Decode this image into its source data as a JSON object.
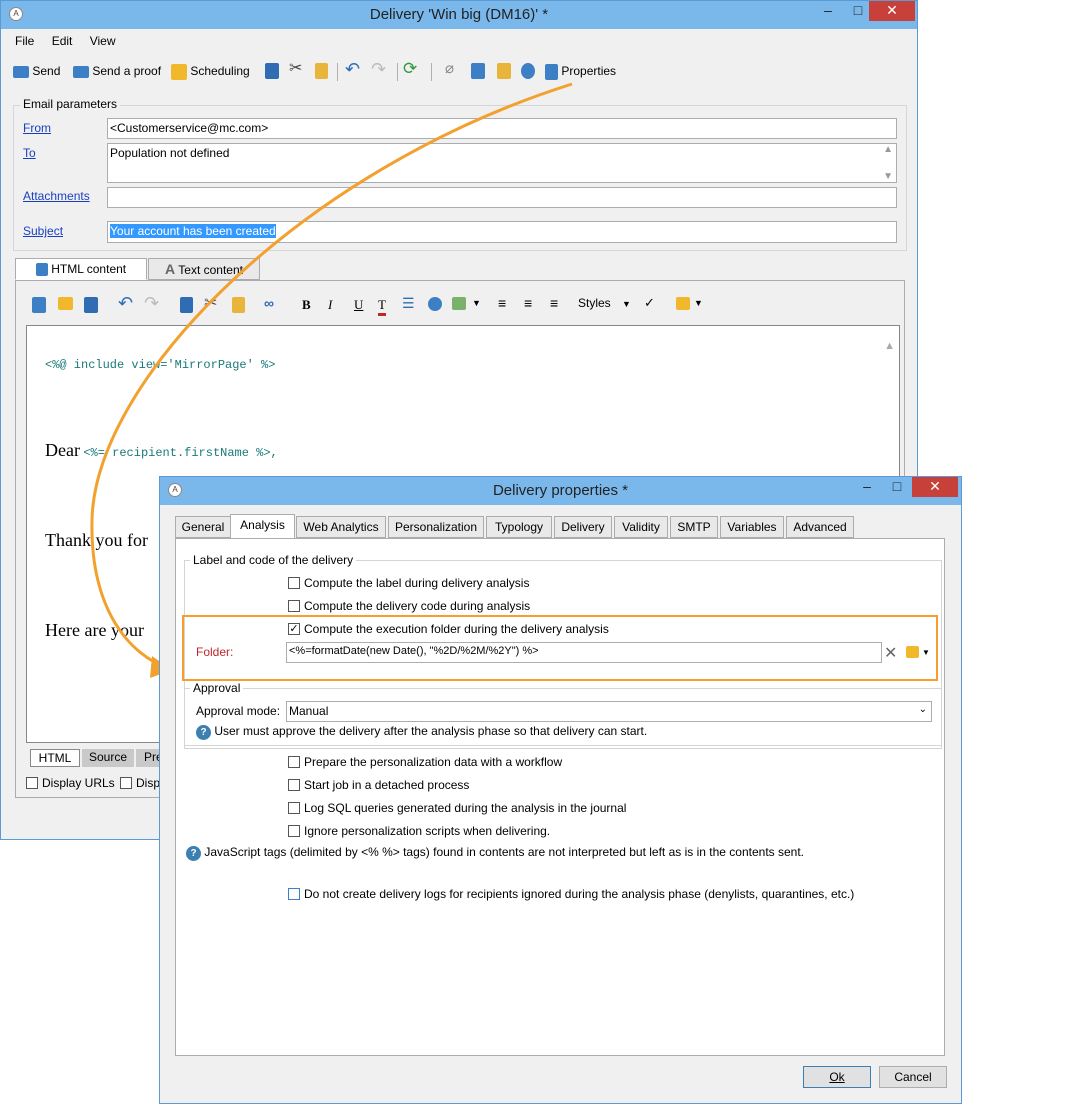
{
  "main_window": {
    "title": "Delivery 'Win big (DM16)' *",
    "menu": [
      "File",
      "Edit",
      "View"
    ],
    "toolbar": {
      "send": "Send",
      "send_proof": "Send a proof",
      "scheduling": "Scheduling",
      "properties": "Properties"
    },
    "email_params": {
      "legend": "Email parameters",
      "from_label": "From",
      "from_value": "<Customerservice@mc.com>",
      "to_label": "To",
      "to_value": "Population not defined",
      "attachments_label": "Attachments",
      "subject_label": "Subject",
      "subject_value": "Your account has been created"
    },
    "content_tabs": [
      "HTML content",
      "Text content"
    ],
    "editor_toolbar": {
      "styles": "Styles"
    },
    "editor": {
      "include_line": "<%@ include view='MirrorPage' %>",
      "dear": "Dear",
      "dear_code": "<%= recipient.firstName %>,",
      "thank_you": "Thank you for",
      "here_are": "Here are your"
    },
    "bottom_tabs": [
      "HTML",
      "Source",
      "Pre"
    ],
    "options": {
      "display_urls": "Display URLs",
      "display_other": "Displ"
    }
  },
  "dialog": {
    "title": "Delivery properties *",
    "tabs": [
      "General",
      "Analysis",
      "Web Analytics",
      "Personalization",
      "Typology",
      "Delivery",
      "Validity",
      "SMTP",
      "Variables",
      "Advanced"
    ],
    "active_tab": "Analysis",
    "label_code_section": {
      "legend": "Label and code of the delivery",
      "compute_label": "Compute the label during delivery analysis",
      "compute_code": "Compute the delivery code during analysis",
      "compute_folder": "Compute the execution folder during the delivery analysis",
      "folder_label": "Folder:",
      "folder_value": "<%=formatDate(new Date(), \"%2D/%2M/%2Y\") %>"
    },
    "approval_section": {
      "legend": "Approval",
      "mode_label": "Approval mode:",
      "mode_value": "Manual",
      "help_text": "User must approve the delivery after the analysis phase so that delivery can start."
    },
    "options": {
      "prepare_workflow": "Prepare the personalization data with a workflow",
      "start_detached": "Start job in a detached process",
      "log_sql": "Log SQL queries generated during the analysis in the journal",
      "ignore_scripts": "Ignore personalization scripts when delivering.",
      "js_help": "JavaScript tags (delimited by <% %> tags) found in contents are not interpreted but left as is in the contents sent.",
      "no_logs": "Do not create delivery logs for recipients ignored during the analysis phase (denylists, quarantines, etc.)"
    },
    "buttons": {
      "ok": "Ok",
      "cancel": "Cancel"
    }
  },
  "colors": {
    "titlebar": "#7ab8ec",
    "accent_orange": "#f2a12e",
    "link": "#1a3fbd",
    "folder_label": "#c0272d"
  }
}
